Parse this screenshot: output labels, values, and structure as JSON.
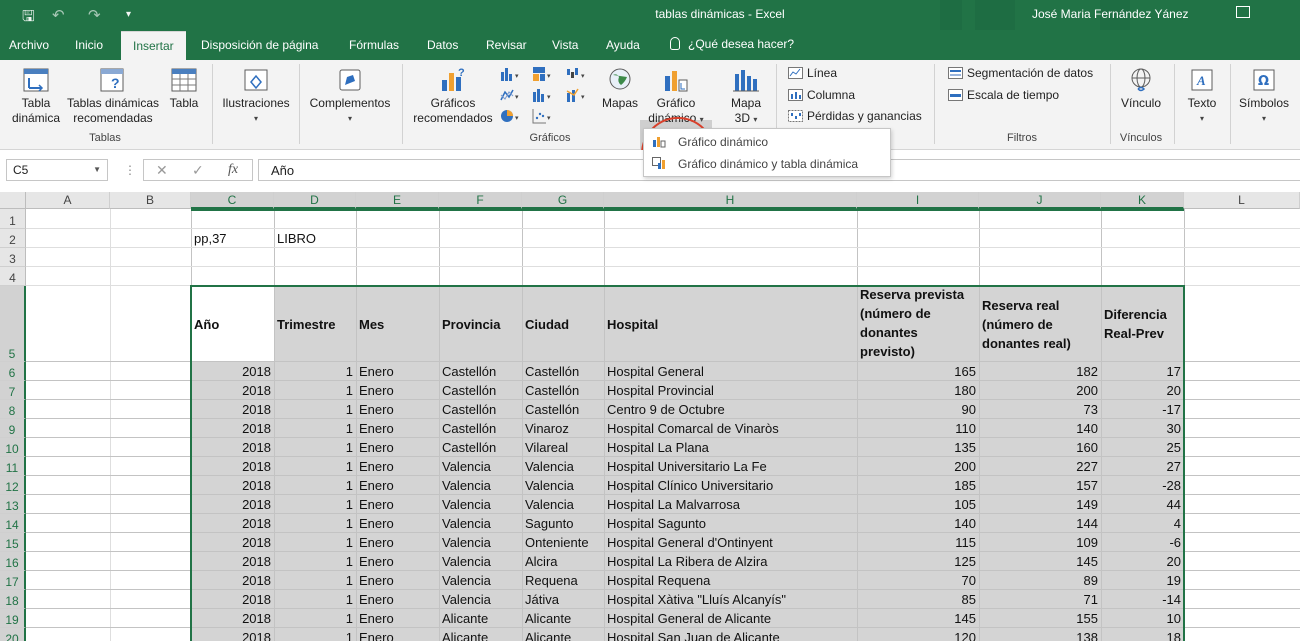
{
  "window": {
    "title": "tablas dinámicas  -  Excel",
    "user": "José Maria Fernández Yánez"
  },
  "tabs": [
    {
      "label": "Archivo",
      "active": false
    },
    {
      "label": "Inicio",
      "active": false
    },
    {
      "label": "Insertar",
      "active": true
    },
    {
      "label": "Disposición de página",
      "active": false
    },
    {
      "label": "Fórmulas",
      "active": false
    },
    {
      "label": "Datos",
      "active": false
    },
    {
      "label": "Revisar",
      "active": false
    },
    {
      "label": "Vista",
      "active": false
    },
    {
      "label": "Ayuda",
      "active": false
    }
  ],
  "tell_me": "¿Qué desea hacer?",
  "ribbon": {
    "tablas": {
      "tabla_dinamica": [
        "Tabla",
        "dinámica"
      ],
      "recomendadas": [
        "Tablas dinámicas",
        "recomendadas"
      ],
      "tabla": "Tabla",
      "group_label": "Tablas"
    },
    "ilustraciones": "Ilustraciones",
    "complementos": "Complementos",
    "graficos": {
      "recomendados": [
        "Gráficos",
        "recomendados"
      ],
      "mapas": "Mapas",
      "grafico_dinamico": [
        "Gráfico",
        "dinámico"
      ],
      "group_label": "Gráficos"
    },
    "mapa3d": [
      "Mapa",
      "3D"
    ],
    "minigraficos": {
      "linea": "Línea",
      "columna": "Columna",
      "perdidas": "Pérdidas y ganancias"
    },
    "filtros": {
      "segmentacion": "Segmentación de datos",
      "escala": "Escala de tiempo",
      "group_label": "Filtros"
    },
    "vinculos": {
      "vinculo": "Vínculo",
      "group_label": "Vínculos"
    },
    "texto": "Texto",
    "simbolos": "Símbolos"
  },
  "dropdown": {
    "items": [
      "Gráfico dinámico",
      "Gráfico dinámico y tabla dinámica"
    ]
  },
  "formula_bar": {
    "name_box": "C5",
    "cancel": "✕",
    "enter": "✓",
    "fx": "fx",
    "value": "Año"
  },
  "columns": [
    "A",
    "B",
    "C",
    "D",
    "E",
    "F",
    "G",
    "H",
    "I",
    "J",
    "K",
    "L"
  ],
  "rows": [
    "1",
    "2",
    "3",
    "4",
    "5",
    "6",
    "7",
    "8",
    "9",
    "10",
    "11",
    "12",
    "13",
    "14",
    "15",
    "16",
    "17",
    "18",
    "19",
    "20"
  ],
  "cells": {
    "c2": "pp,37",
    "d2": "LIBRO"
  },
  "table": {
    "headers": {
      "anio": [
        "Año"
      ],
      "trimestre": [
        "Trimestre"
      ],
      "mes": [
        "Mes"
      ],
      "provincia": [
        "Provincia"
      ],
      "ciudad": [
        "Ciudad"
      ],
      "hospital": [
        "Hospital"
      ],
      "prevista": [
        "Reserva prevista",
        "(número de",
        "donantes",
        "previsto)"
      ],
      "real": [
        "Reserva real",
        "(número de",
        "donantes real)"
      ],
      "diferencia": [
        "Diferencia",
        "Real-Prev"
      ]
    },
    "rows": [
      [
        "2018",
        "1",
        "Enero",
        "Castellón",
        "Castellón",
        "Hospital General",
        "165",
        "182",
        "17"
      ],
      [
        "2018",
        "1",
        "Enero",
        "Castellón",
        "Castellón",
        "Hospital Provincial",
        "180",
        "200",
        "20"
      ],
      [
        "2018",
        "1",
        "Enero",
        "Castellón",
        "Castellón",
        "Centro 9 de Octubre",
        "90",
        "73",
        "-17"
      ],
      [
        "2018",
        "1",
        "Enero",
        "Castellón",
        "Vinaroz",
        "Hospital Comarcal de Vinaròs",
        "110",
        "140",
        "30"
      ],
      [
        "2018",
        "1",
        "Enero",
        "Castellón",
        "Vilareal",
        "Hospital La Plana",
        "135",
        "160",
        "25"
      ],
      [
        "2018",
        "1",
        "Enero",
        "Valencia",
        "Valencia",
        "Hospital Universitario La Fe",
        "200",
        "227",
        "27"
      ],
      [
        "2018",
        "1",
        "Enero",
        "Valencia",
        "Valencia",
        "Hospital Clínico Universitario",
        "185",
        "157",
        "-28"
      ],
      [
        "2018",
        "1",
        "Enero",
        "Valencia",
        "Valencia",
        "Hospital La Malvarrosa",
        "105",
        "149",
        "44"
      ],
      [
        "2018",
        "1",
        "Enero",
        "Valencia",
        "Sagunto",
        "Hospital Sagunto",
        "140",
        "144",
        "4"
      ],
      [
        "2018",
        "1",
        "Enero",
        "Valencia",
        "Onteniente",
        "Hospital General d'Ontinyent",
        "115",
        "109",
        "-6"
      ],
      [
        "2018",
        "1",
        "Enero",
        "Valencia",
        "Alcira",
        "Hospital La Ribera de Alzira",
        "125",
        "145",
        "20"
      ],
      [
        "2018",
        "1",
        "Enero",
        "Valencia",
        "Requena",
        "Hospital Requena",
        "70",
        "89",
        "19"
      ],
      [
        "2018",
        "1",
        "Enero",
        "Valencia",
        "Játiva",
        "Hospital Xàtiva \"Lluís Alcanyís\"",
        "85",
        "71",
        "-14"
      ],
      [
        "2018",
        "1",
        "Enero",
        "Alicante",
        "Alicante",
        "Hospital General de Alicante",
        "145",
        "155",
        "10"
      ],
      [
        "2018",
        "1",
        "Enero",
        "Alicante",
        "Alicante",
        "Hospital San Juan de Alicante",
        "120",
        "138",
        "18"
      ]
    ]
  },
  "colors": {
    "excel_green": "#217346",
    "highlight_circle": "#d9402b",
    "selection_shade": "#d4d4d4"
  }
}
